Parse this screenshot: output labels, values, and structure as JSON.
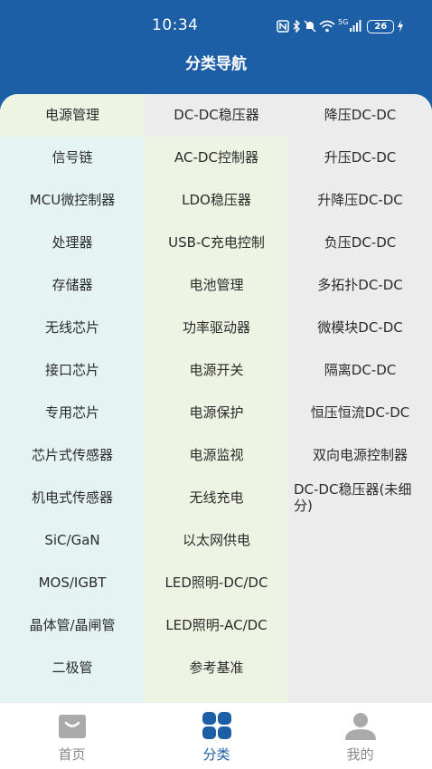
{
  "status_bar": {
    "time": "10:34",
    "battery": "26",
    "signal_label": "5G"
  },
  "header": {
    "title": "分类导航"
  },
  "columns": [
    {
      "items": [
        "电源管理",
        "信号链",
        "MCU微控制器",
        "处理器",
        "存储器",
        "无线芯片",
        "接口芯片",
        "专用芯片",
        "芯片式传感器",
        "机电式传感器",
        "SiC/GaN",
        "MOS/IGBT",
        "晶体管/晶闸管",
        "二极管"
      ],
      "selected_index": 0
    },
    {
      "items": [
        "DC-DC稳压器",
        "AC-DC控制器",
        "LDO稳压器",
        "USB-C充电控制",
        "电池管理",
        "功率驱动器",
        "电源开关",
        "电源保护",
        "电源监视",
        "无线充电",
        "以太网供电",
        "LED照明-DC/DC",
        "LED照明-AC/DC",
        "参考基准"
      ],
      "selected_index": 0
    },
    {
      "items": [
        "降压DC-DC",
        "升压DC-DC",
        "升降压DC-DC",
        "负压DC-DC",
        "多拓扑DC-DC",
        "微模块DC-DC",
        "隔离DC-DC",
        "恒压恒流DC-DC",
        "双向电源控制器",
        "DC-DC稳压器(未细分)"
      ]
    }
  ],
  "tabbar": {
    "tabs": [
      {
        "label": "首页",
        "icon": "shopping-bag-icon",
        "active": false
      },
      {
        "label": "分类",
        "icon": "grid-icon",
        "active": true
      },
      {
        "label": "我的",
        "icon": "user-icon",
        "active": false
      }
    ]
  },
  "colors": {
    "header_bg": "#1d5fa7",
    "col1_bg": "#e6f3f3",
    "col2_bg": "#eef4e3",
    "col3_bg": "#ececec",
    "active_tab": "#1d5fa7",
    "inactive_tab": "#888888"
  }
}
